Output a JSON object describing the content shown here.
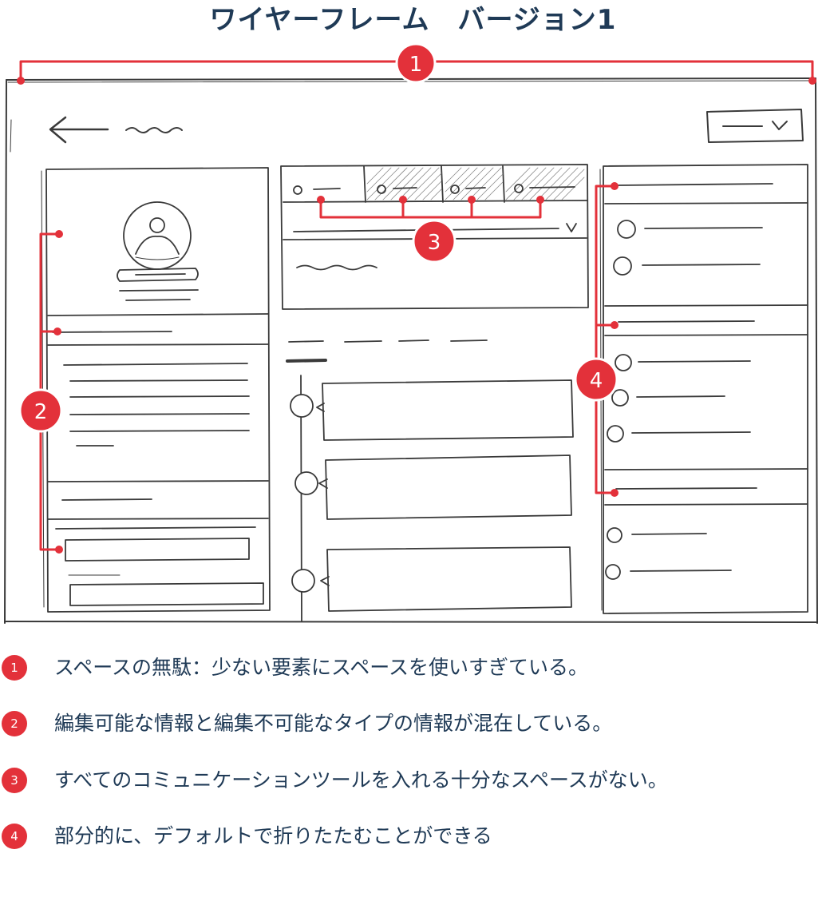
{
  "title": "ワイヤーフレーム　バージョン1",
  "markers": [
    "1",
    "2",
    "3",
    "4"
  ],
  "legend": [
    {
      "num": "1",
      "text": "スペースの無駄：少ない要素にスペースを使いすぎている。"
    },
    {
      "num": "2",
      "text": "編集可能な情報と編集不可能なタイプの情報が混在している。"
    },
    {
      "num": "3",
      "text": "すべてのコミュニケーションツールを入れる十分なスペースがない。"
    },
    {
      "num": "4",
      "text": "部分的に、デフォルトで折りたたむことができる"
    }
  ],
  "colors": {
    "accent": "#e3313a",
    "title": "#1f3a56",
    "sketch": "#3a3a3a"
  },
  "icons": [
    "back-arrow-icon",
    "chevron-down-icon",
    "avatar-icon"
  ]
}
